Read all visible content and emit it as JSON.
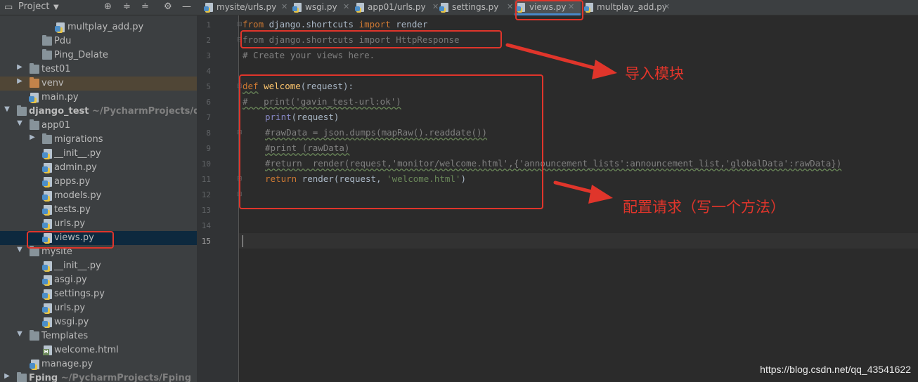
{
  "project_panel": {
    "title": "Project",
    "tree": [
      {
        "label": "multplay_add.py",
        "kind": "py"
      },
      {
        "label": "Pdu",
        "kind": "folder-plain"
      },
      {
        "label": "Ping_Delate",
        "kind": "folder-plain"
      },
      {
        "label": "test01",
        "kind": "folder"
      },
      {
        "label": "venv",
        "kind": "folder-orange"
      },
      {
        "label": "main.py",
        "kind": "py"
      },
      {
        "label": "django_test",
        "path": "~/PycharmProjects/django",
        "kind": "folder"
      },
      {
        "label": "app01",
        "kind": "folder"
      },
      {
        "label": "migrations",
        "kind": "folder"
      },
      {
        "label": "__init__.py",
        "kind": "py"
      },
      {
        "label": "admin.py",
        "kind": "py"
      },
      {
        "label": "apps.py",
        "kind": "py"
      },
      {
        "label": "models.py",
        "kind": "py"
      },
      {
        "label": "tests.py",
        "kind": "py"
      },
      {
        "label": "urls.py",
        "kind": "py"
      },
      {
        "label": "views.py",
        "kind": "py"
      },
      {
        "label": "mysite",
        "kind": "folder"
      },
      {
        "label": "__init__.py",
        "kind": "py"
      },
      {
        "label": "asgi.py",
        "kind": "py"
      },
      {
        "label": "settings.py",
        "kind": "py"
      },
      {
        "label": "urls.py",
        "kind": "py"
      },
      {
        "label": "wsgi.py",
        "kind": "py"
      },
      {
        "label": "Templates",
        "kind": "folder"
      },
      {
        "label": "welcome.html",
        "kind": "html"
      },
      {
        "label": "manage.py",
        "kind": "py"
      },
      {
        "label": "Fping",
        "path": "~/PycharmProjects/Fping",
        "kind": "folder"
      }
    ]
  },
  "tabs": [
    {
      "label": "mysite/urls.py"
    },
    {
      "label": "wsgi.py"
    },
    {
      "label": "app01/urls.py"
    },
    {
      "label": "settings.py"
    },
    {
      "label": "views.py",
      "active": true
    },
    {
      "label": "multplay_add.py"
    }
  ],
  "editor": {
    "line_numbers": [
      "1",
      "2",
      "3",
      "4",
      "5",
      "6",
      "7",
      "8",
      "9",
      "10",
      "11",
      "12",
      "13",
      "14",
      "15"
    ],
    "current_line": "15",
    "code": {
      "l1_a": "from",
      "l1_b": " django.shortcuts ",
      "l1_c": "import",
      "l1_d": " render",
      "l2": "from django.shortcuts import HttpResponse",
      "l3": "# Create your views here.",
      "l5_a": "def",
      "l5_b": "welcome",
      "l5_c": "(request):",
      "l6": "#   print('gavin_test-url:ok')",
      "l7_a": "print",
      "l7_b": "(request)",
      "l8": "#rawData = json.dumps(mapRaw().readdate())",
      "l9": "#print (rawData)",
      "l10": "#return  render(request,'monitor/welcome.html',{'announcement_lists':announcement_list,'globalData':rawData})",
      "l11_a": "return",
      "l11_b": " render(request, ",
      "l11_c": "'welcome.html'",
      "l11_d": ")"
    }
  },
  "annotations": {
    "import_module": "导入模块",
    "configure_request": "配置请求（写一个方法）",
    "color": "#e0352b"
  },
  "watermark": "https://blog.csdn.net/qq_43541622"
}
